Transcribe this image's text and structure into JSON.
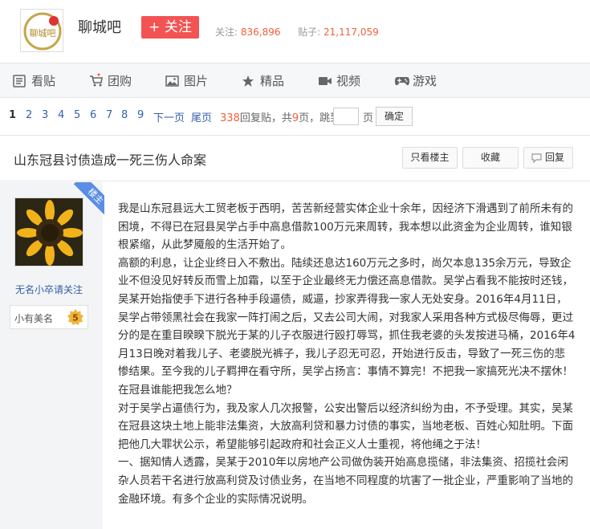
{
  "header": {
    "logo_text": "聊城吧",
    "forum_name": "聊城吧",
    "follow_label": "+ 关注",
    "followers_label": "关注:",
    "followers_count": "836,896",
    "posts_label": "贴子:",
    "posts_count": "21,117,059"
  },
  "nav": {
    "items": [
      {
        "label": "看贴",
        "icon": "list-icon"
      },
      {
        "label": "团购",
        "icon": "cart-icon"
      },
      {
        "label": "图片",
        "icon": "image-icon"
      },
      {
        "label": "精品",
        "icon": "star-icon"
      },
      {
        "label": "视频",
        "icon": "video-icon"
      },
      {
        "label": "游戏",
        "icon": "gamepad-icon"
      }
    ]
  },
  "pager": {
    "pages": [
      "1",
      "2",
      "3",
      "4",
      "5",
      "6",
      "7",
      "8",
      "9"
    ],
    "current": "1",
    "next": "下一页",
    "last": "尾页",
    "reply_count": "338",
    "reply_text": "回复贴，共",
    "page_count": "9",
    "page_text": "页，跳到",
    "ye": "页",
    "confirm": "确定"
  },
  "thread": {
    "title": "山东冠县讨债造成一死三伤人命案",
    "only_op": "只看楼主",
    "favorite": "收藏",
    "reply": "回复"
  },
  "author": {
    "badge": "楼主",
    "name": "无名小卒请关注",
    "level_name": "小有美名",
    "level": "5"
  },
  "post": {
    "paragraphs": [
      "我是山东冠县远大工贸老板于西明，苦苦新经营实体企业十余年，因经济下滑遇到了前所未有的困境，不得已在冠县吴学占手中高息借款100万元来周转，我本想以此资金为企业周转，谁知银根紧缩，从此梦魇般的生活开始了。",
      "高额的利息，让企业终日入不敷出。陆续还息达160万元之多时，尚欠本息135余万元，导致企业不但没见好转反而雪上加霜，以至于企业最终无力偿还高息借款。吴学占看我不能按时还钱，吴某开始指使手下进行各种手段逼债，威逼，抄家弄得我一家人无处安身。2016年4月11日，吴学占带领黑社会在我家一阵打闹之后，又去公司大闹，对我家人采用各种方式极尽侮辱，更过分的是在重目睽睽下脱光于某的儿子衣服进行殴打辱骂，抓住我老婆的头发按进马桶，2016年4月13日晚对着我儿子、老婆脱光裤子，我儿子忍无可忍，开始进行反击，导致了一死三伤的悲惨结果。至今我的儿子羁押在看守所，吴学占扬言：事情不算完！不把我一家搞死光决不摆休！在冠县谁能把我怎么地？",
      "对于吴学占逼债行为，我及家人几次报警，公安出警后以经济纠纷为由，不予受理。其实，吴某在冠县这块土地上能非法集资，大放高利贷和暴力讨债的事实，当地老板、百姓心知肚明。下面把他几大罪状公示，希望能够引起政府和社会正义人士重视，将他绳之于法！",
      "一、据知情人透露，吴某于2010年以房地产公司做伪装开始高息揽储，非法集资、招揽社会闲杂人员若干名进行放高利贷及讨债业务，在当地不同程度的坑害了一批企业，严重影响了当地的金融环境。有多个企业的实际情况说明。"
    ]
  },
  "colors": {
    "follow": "#f35353",
    "link": "#3560a8",
    "accent": "#f25e3a",
    "ribbon": "#5b8de6"
  }
}
